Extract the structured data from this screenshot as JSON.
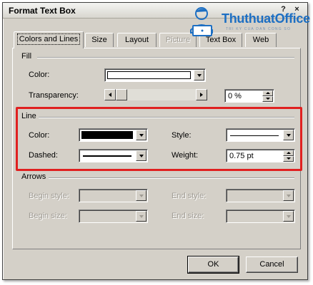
{
  "window": {
    "title": "Format Text Box",
    "help": "?",
    "close": "×"
  },
  "watermark": {
    "brand": "ThuthuatOffice",
    "tagline": "TRI KY CUA DAN CONG SO"
  },
  "tabs": [
    {
      "label": "Colors and Lines",
      "active": true
    },
    {
      "label": "Size"
    },
    {
      "label": "Layout"
    },
    {
      "label": "Picture",
      "disabled": true
    },
    {
      "label": "Text Box"
    },
    {
      "label": "Web"
    }
  ],
  "fill": {
    "heading": "Fill",
    "color_label": "Color:",
    "color_value": "#ffffff",
    "transparency_label": "Transparency:",
    "transparency_value": "0 %",
    "transparency_fraction": 0
  },
  "line": {
    "heading": "Line",
    "color_label": "Color:",
    "color_value": "#000000",
    "dashed_label": "Dashed:",
    "style_label": "Style:",
    "weight_label": "Weight:",
    "weight_value": "0.75 pt"
  },
  "arrows": {
    "heading": "Arrows",
    "begin_style_label": "Begin style:",
    "begin_size_label": "Begin size:",
    "end_style_label": "End style:",
    "end_size_label": "End size:"
  },
  "buttons": {
    "ok": "OK",
    "cancel": "Cancel"
  },
  "colors": {
    "highlight": "#e02020",
    "dialog_face": "#d4d0c8",
    "brand_blue": "#1d6fc3"
  }
}
